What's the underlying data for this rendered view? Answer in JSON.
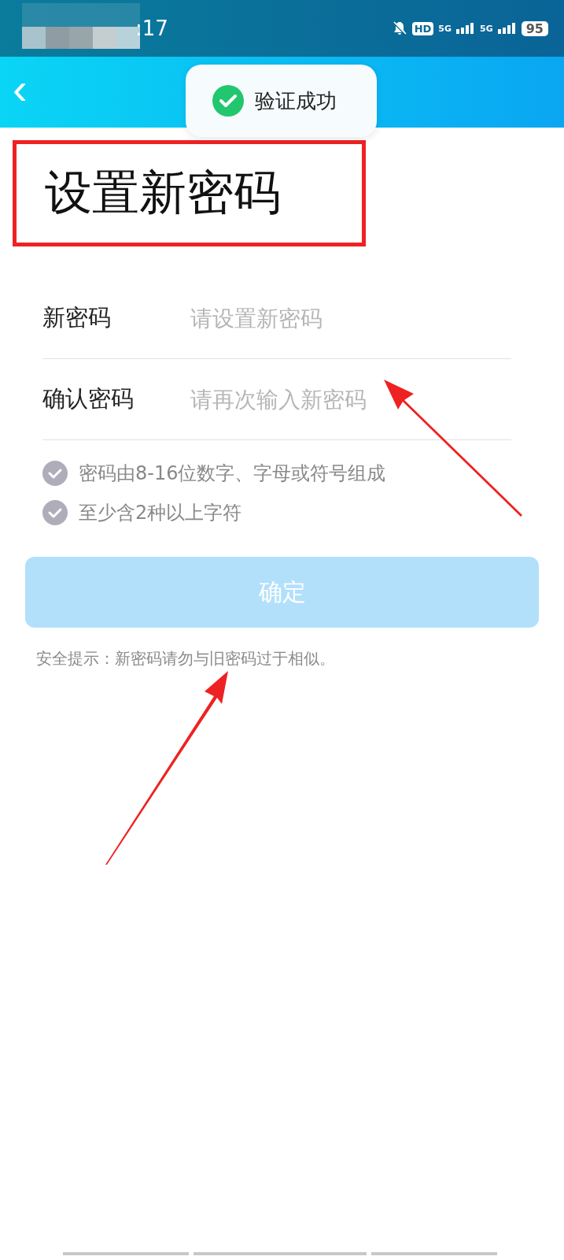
{
  "status_bar": {
    "time": ":17",
    "network_1": "5G",
    "network_2": "5G",
    "hd": "HD",
    "battery": "95"
  },
  "header": {
    "back": "‹"
  },
  "toast": {
    "text": "验证成功"
  },
  "title": "设置新密码",
  "fields": [
    {
      "label": "新密码",
      "placeholder": "请设置新密码"
    },
    {
      "label": "确认密码",
      "placeholder": "请再次输入新密码"
    }
  ],
  "rules": [
    {
      "text": "密码由8-16位数字、字母或符号组成",
      "checked": false
    },
    {
      "text": "至少含2种以上字符",
      "checked": false
    }
  ],
  "confirm_button": {
    "label": "确定",
    "disabled": true
  },
  "security_tip": "安全提示：新密码请勿与旧密码过于相似。"
}
